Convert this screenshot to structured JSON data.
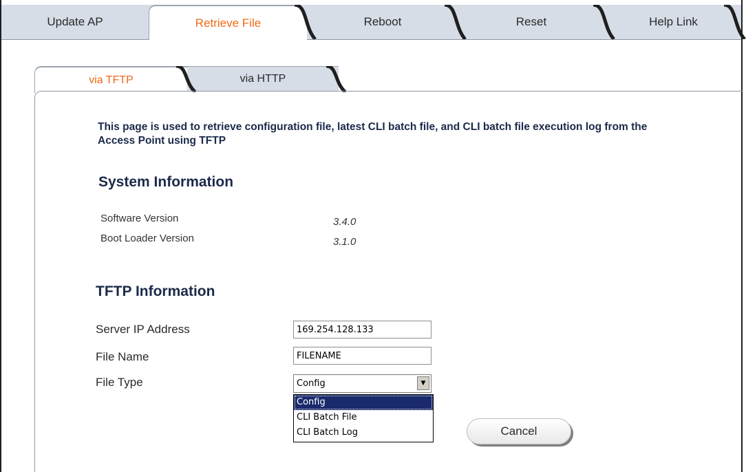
{
  "top_tabs": [
    {
      "label": "Update AP"
    },
    {
      "label": "Retrieve File"
    },
    {
      "label": "Reboot"
    },
    {
      "label": "Reset"
    },
    {
      "label": "Help Link"
    }
  ],
  "sub_tabs": [
    {
      "label": "via TFTP"
    },
    {
      "label": "via HTTP"
    }
  ],
  "intro_text": "This page is used to retrieve configuration file, latest CLI batch file, and CLI batch file execution log from the Access Point using TFTP",
  "system_info": {
    "title": "System Information",
    "software_label": "Software Version",
    "software_value": "3.4.0",
    "boot_label": "Boot Loader Version",
    "boot_value": "3.1.0"
  },
  "tftp_info": {
    "title": "TFTP Information",
    "server_label": "Server IP Address",
    "server_value": "169.254.128.133",
    "file_name_label": "File Name",
    "file_name_value": "FILENAME",
    "file_type_label": "File Type",
    "file_type_selected": "Config",
    "file_type_options": [
      "Config",
      "CLI Batch File",
      "CLI Batch Log"
    ]
  },
  "buttons": {
    "cancel": "Cancel"
  },
  "colors": {
    "active_tab_text": "#ef6a16",
    "tab_bg": "#d7dde7",
    "heading": "#1b2a4a",
    "selected_option_bg": "#1a2a6c"
  }
}
